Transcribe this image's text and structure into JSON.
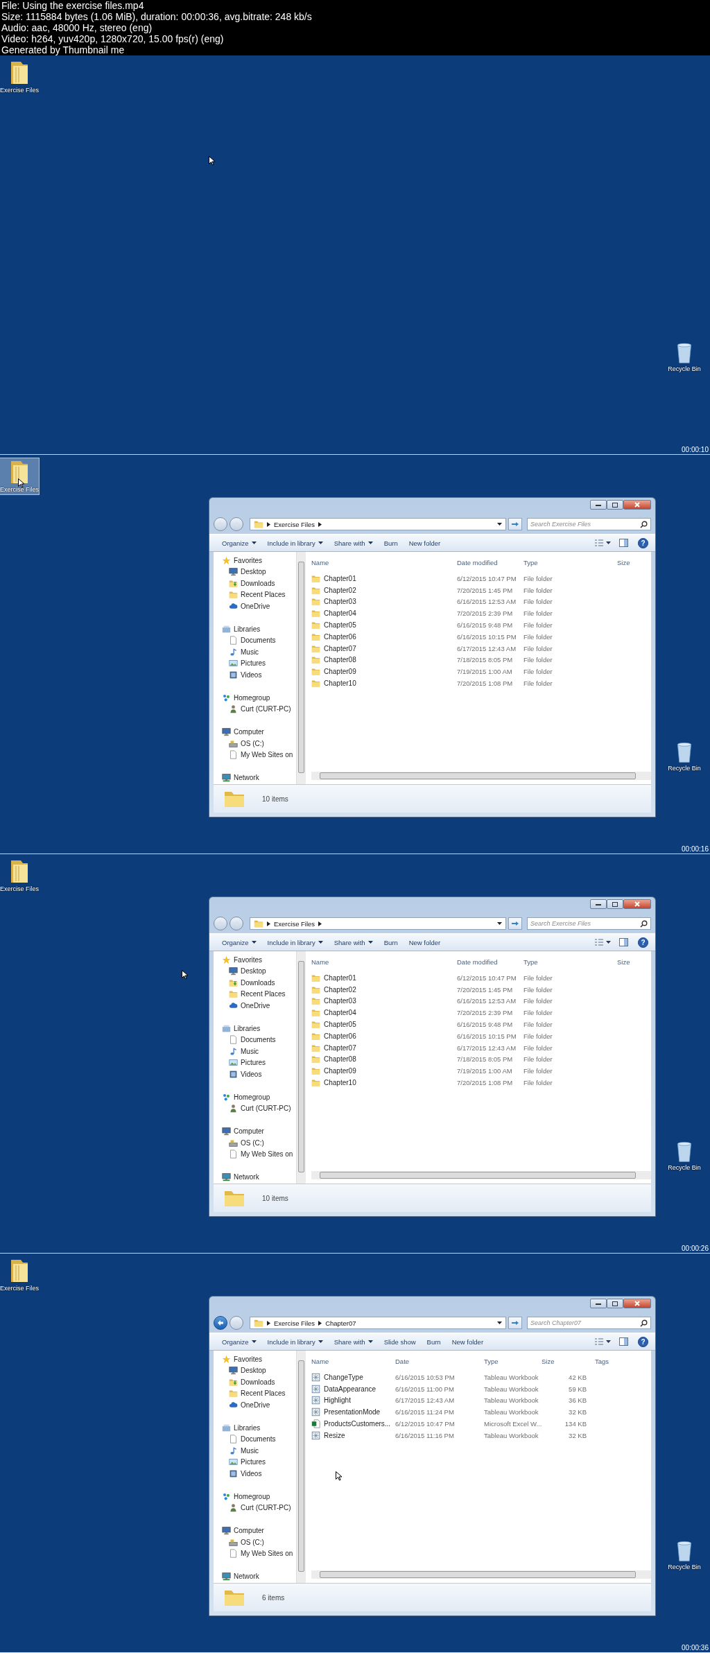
{
  "header": {
    "lines": [
      "File: Using the exercise files.mp4",
      "Size: 1115884 bytes (1.06 MiB), duration: 00:00:36, avg.bitrate: 248 kb/s",
      "Audio: aac, 48000 Hz, stereo (eng)",
      "Video: h264, yuv420p, 1280x720, 15.00 fps(r) (eng)",
      "Generated by Thumbnail me"
    ]
  },
  "frames": [
    {
      "timestamp": "00:00:10",
      "desktop_icons": [
        {
          "kind": "folder",
          "label": "Exercise Files",
          "selected": false
        },
        {
          "kind": "recycle_bin",
          "label": "Recycle Bin",
          "selected": false
        }
      ]
    },
    {
      "timestamp": "00:00:16",
      "desktop_icons": [
        {
          "kind": "folder",
          "label": "Exercise Files",
          "selected": true
        },
        {
          "kind": "recycle_bin",
          "label": "Recycle Bin",
          "selected": false
        }
      ],
      "explorer": {
        "back_enabled": false,
        "path": [
          "Exercise Files"
        ],
        "search": {
          "placeholder": "Search Exercise Files"
        },
        "toolbar": [
          {
            "label": "Organize",
            "dropdown": true
          },
          {
            "label": "Include in library",
            "dropdown": true
          },
          {
            "label": "Share with",
            "dropdown": true
          },
          {
            "label": "Burn",
            "dropdown": false
          },
          {
            "label": "New folder",
            "dropdown": false
          }
        ],
        "help_label": "?",
        "nav": [
          {
            "label": "Favorites",
            "children": [
              {
                "label": "Desktop"
              },
              {
                "label": "Downloads"
              },
              {
                "label": "Recent Places"
              },
              {
                "label": "OneDrive"
              }
            ]
          },
          {
            "label": "Libraries",
            "children": [
              {
                "label": "Documents"
              },
              {
                "label": "Music"
              },
              {
                "label": "Pictures"
              },
              {
                "label": "Videos"
              }
            ]
          },
          {
            "label": "Homegroup",
            "children": [
              {
                "label": "Curt (CURT-PC)"
              }
            ]
          },
          {
            "label": "Computer",
            "children": [
              {
                "label": "OS (C:)"
              },
              {
                "label": "My Web Sites on"
              }
            ]
          },
          {
            "label": "Network"
          }
        ],
        "columns": [
          "Name",
          "Date modified",
          "Type",
          "Size"
        ],
        "rows": [
          {
            "kind": "folder",
            "cells": [
              "Chapter01",
              "6/12/2015 10:47 PM",
              "File folder"
            ]
          },
          {
            "kind": "folder",
            "cells": [
              "Chapter02",
              "7/20/2015 1:45 PM",
              "File folder"
            ]
          },
          {
            "kind": "folder",
            "cells": [
              "Chapter03",
              "6/16/2015 12:53 AM",
              "File folder"
            ]
          },
          {
            "kind": "folder",
            "cells": [
              "Chapter04",
              "7/20/2015 2:39 PM",
              "File folder"
            ]
          },
          {
            "kind": "folder",
            "cells": [
              "Chapter05",
              "6/16/2015 9:48 PM",
              "File folder"
            ]
          },
          {
            "kind": "folder",
            "cells": [
              "Chapter06",
              "6/16/2015 10:15 PM",
              "File folder"
            ]
          },
          {
            "kind": "folder",
            "cells": [
              "Chapter07",
              "6/17/2015 12:43 AM",
              "File folder"
            ]
          },
          {
            "kind": "folder",
            "cells": [
              "Chapter08",
              "7/18/2015 8:05 PM",
              "File folder"
            ]
          },
          {
            "kind": "folder",
            "cells": [
              "Chapter09",
              "7/19/2015 1:00 AM",
              "File folder"
            ]
          },
          {
            "kind": "folder",
            "cells": [
              "Chapter10",
              "7/20/2015 1:08 PM",
              "File folder"
            ]
          }
        ],
        "status": "10 items"
      }
    },
    {
      "timestamp": "00:00:26",
      "desktop_icons": [
        {
          "kind": "folder",
          "label": "Exercise Files",
          "selected": false
        },
        {
          "kind": "recycle_bin",
          "label": "Recycle Bin",
          "selected": false
        }
      ],
      "explorer": {
        "back_enabled": false,
        "path": [
          "Exercise Files"
        ],
        "search": {
          "placeholder": "Search Exercise Files"
        },
        "toolbar": [
          {
            "label": "Organize",
            "dropdown": true
          },
          {
            "label": "Include in library",
            "dropdown": true
          },
          {
            "label": "Share with",
            "dropdown": true
          },
          {
            "label": "Burn",
            "dropdown": false
          },
          {
            "label": "New folder",
            "dropdown": false
          }
        ],
        "help_label": "?",
        "nav": [
          {
            "label": "Favorites",
            "children": [
              {
                "label": "Desktop"
              },
              {
                "label": "Downloads"
              },
              {
                "label": "Recent Places"
              },
              {
                "label": "OneDrive"
              }
            ]
          },
          {
            "label": "Libraries",
            "children": [
              {
                "label": "Documents"
              },
              {
                "label": "Music"
              },
              {
                "label": "Pictures"
              },
              {
                "label": "Videos"
              }
            ]
          },
          {
            "label": "Homegroup",
            "children": [
              {
                "label": "Curt (CURT-PC)"
              }
            ]
          },
          {
            "label": "Computer",
            "children": [
              {
                "label": "OS (C:)"
              },
              {
                "label": "My Web Sites on"
              }
            ]
          },
          {
            "label": "Network"
          }
        ],
        "columns": [
          "Name",
          "Date modified",
          "Type",
          "Size"
        ],
        "rows": [
          {
            "kind": "folder",
            "cells": [
              "Chapter01",
              "6/12/2015 10:47 PM",
              "File folder"
            ]
          },
          {
            "kind": "folder",
            "cells": [
              "Chapter02",
              "7/20/2015 1:45 PM",
              "File folder"
            ]
          },
          {
            "kind": "folder",
            "cells": [
              "Chapter03",
              "6/16/2015 12:53 AM",
              "File folder"
            ]
          },
          {
            "kind": "folder",
            "cells": [
              "Chapter04",
              "7/20/2015 2:39 PM",
              "File folder"
            ]
          },
          {
            "kind": "folder",
            "cells": [
              "Chapter05",
              "6/16/2015 9:48 PM",
              "File folder"
            ]
          },
          {
            "kind": "folder",
            "cells": [
              "Chapter06",
              "6/16/2015 10:15 PM",
              "File folder"
            ]
          },
          {
            "kind": "folder",
            "cells": [
              "Chapter07",
              "6/17/2015 12:43 AM",
              "File folder"
            ]
          },
          {
            "kind": "folder",
            "cells": [
              "Chapter08",
              "7/18/2015 8:05 PM",
              "File folder"
            ]
          },
          {
            "kind": "folder",
            "cells": [
              "Chapter09",
              "7/19/2015 1:00 AM",
              "File folder"
            ]
          },
          {
            "kind": "folder",
            "cells": [
              "Chapter10",
              "7/20/2015 1:08 PM",
              "File folder"
            ]
          }
        ],
        "status": "10 items"
      }
    },
    {
      "timestamp": "00:00:36",
      "desktop_icons": [
        {
          "kind": "folder",
          "label": "Exercise Files",
          "selected": false
        },
        {
          "kind": "recycle_bin",
          "label": "Recycle Bin",
          "selected": false
        }
      ],
      "explorer": {
        "back_enabled": true,
        "path": [
          "Exercise Files",
          "Chapter07"
        ],
        "search": {
          "placeholder": "Search Chapter07"
        },
        "toolbar": [
          {
            "label": "Organize",
            "dropdown": true
          },
          {
            "label": "Include in library",
            "dropdown": true
          },
          {
            "label": "Share with",
            "dropdown": true
          },
          {
            "label": "Slide show",
            "dropdown": false
          },
          {
            "label": "Burn",
            "dropdown": false
          },
          {
            "label": "New folder",
            "dropdown": false
          }
        ],
        "help_label": "?",
        "nav": [
          {
            "label": "Favorites",
            "children": [
              {
                "label": "Desktop"
              },
              {
                "label": "Downloads"
              },
              {
                "label": "Recent Places"
              },
              {
                "label": "OneDrive"
              }
            ]
          },
          {
            "label": "Libraries",
            "children": [
              {
                "label": "Documents"
              },
              {
                "label": "Music"
              },
              {
                "label": "Pictures"
              },
              {
                "label": "Videos"
              }
            ]
          },
          {
            "label": "Homegroup",
            "children": [
              {
                "label": "Curt (CURT-PC)"
              }
            ]
          },
          {
            "label": "Computer",
            "children": [
              {
                "label": "OS (C:)"
              },
              {
                "label": "My Web Sites on"
              }
            ]
          },
          {
            "label": "Network"
          }
        ],
        "columns": [
          "Name",
          "Date",
          "Type",
          "Size",
          "Tags"
        ],
        "rows": [
          {
            "kind": "tableau",
            "cells": [
              "ChangeType",
              "6/16/2015 10:53 PM",
              "Tableau Workbook",
              "42 KB"
            ]
          },
          {
            "kind": "tableau",
            "cells": [
              "DataAppearance",
              "6/16/2015 11:00 PM",
              "Tableau Workbook",
              "59 KB"
            ]
          },
          {
            "kind": "tableau",
            "cells": [
              "Highlight",
              "6/17/2015 12:43 AM",
              "Tableau Workbook",
              "36 KB"
            ]
          },
          {
            "kind": "tableau",
            "cells": [
              "PresentationMode",
              "6/16/2015 11:24 PM",
              "Tableau Workbook",
              "32 KB"
            ]
          },
          {
            "kind": "excel",
            "cells": [
              "ProductsCustomers...",
              "6/12/2015 10:47 PM",
              "Microsoft Excel W...",
              "134 KB"
            ]
          },
          {
            "kind": "tableau",
            "cells": [
              "Resize",
              "6/16/2015 11:16 PM",
              "Tableau Workbook",
              "32 KB"
            ]
          }
        ],
        "status": "6 items"
      }
    }
  ]
}
